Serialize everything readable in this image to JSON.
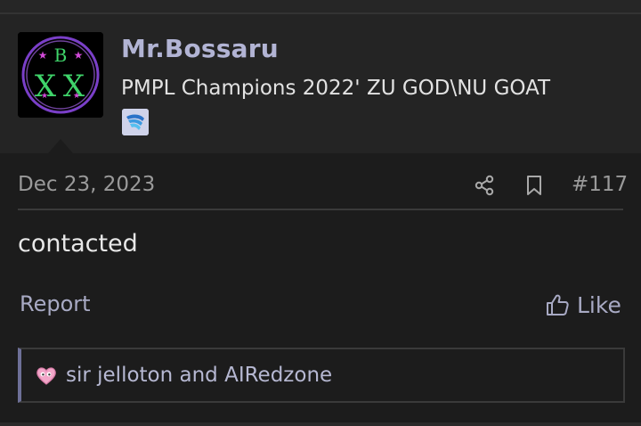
{
  "post": {
    "user": {
      "name": "Mr.Bossaru",
      "title": "PMPL Champions 2022' ZU GOD\\NU GOAT",
      "avatar_icon": "xbx-logo-avatar",
      "badge_icon": "wing-badge-icon"
    },
    "date": "Dec 23, 2023",
    "number": "#117",
    "message": "contacted",
    "actions": {
      "report_label": "Report",
      "like_label": "Like"
    },
    "reactions": {
      "icon": "heart-reaction-icon",
      "users_text": "sir jelloton and AIRedzone"
    }
  },
  "colors": {
    "accent": "#b2b4d4",
    "link": "#a8aac4",
    "background": "#1c1c1c",
    "panel": "#242424"
  }
}
